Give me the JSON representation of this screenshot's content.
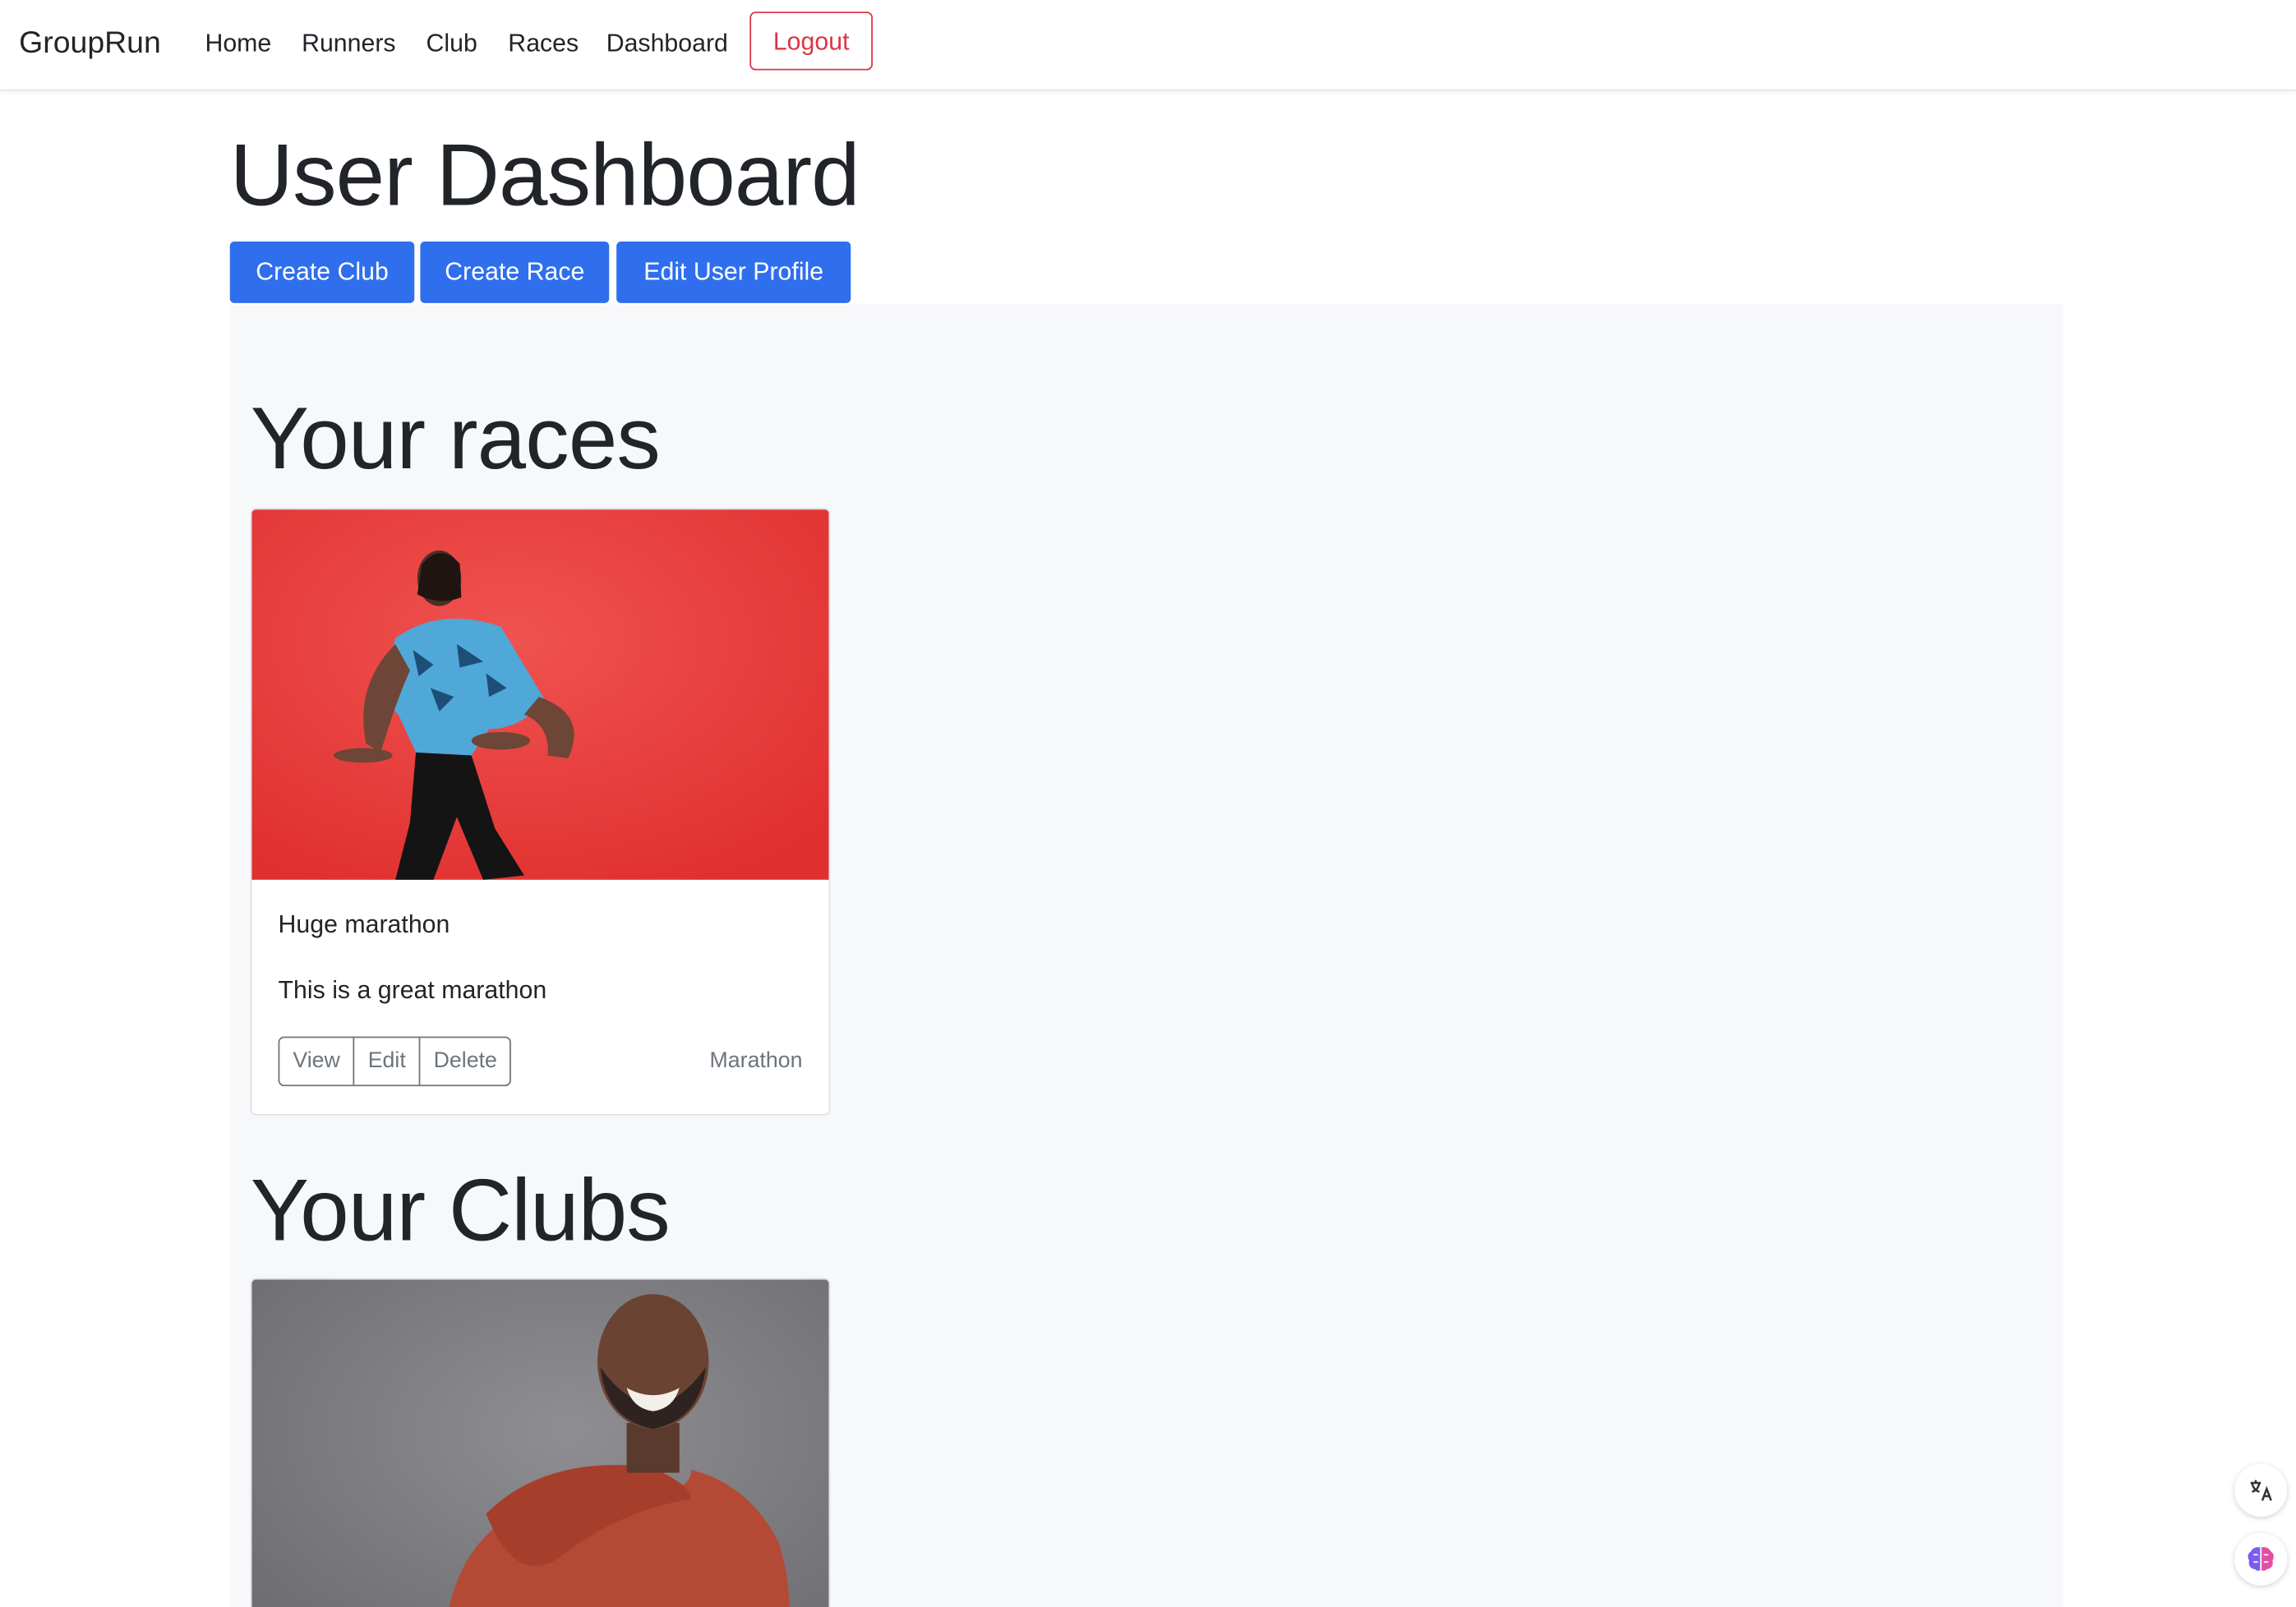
{
  "navbar": {
    "brand": "GroupRun",
    "links": [
      "Home",
      "Runners",
      "Club",
      "Races",
      "Dashboard"
    ],
    "logout_label": "Logout"
  },
  "page": {
    "title": "User Dashboard",
    "actions": [
      "Create Club",
      "Create Race",
      "Edit User Profile"
    ]
  },
  "races": {
    "heading": "Your races",
    "items": [
      {
        "title": "Huge marathon",
        "description": "This is a great marathon",
        "buttons": [
          "View",
          "Edit",
          "Delete"
        ],
        "category": "Marathon",
        "image_bg": "#e53e3e"
      }
    ]
  },
  "clubs": {
    "heading": "Your Clubs",
    "items": [
      {
        "image_bg": "#7b7b7e"
      }
    ]
  },
  "colors": {
    "primary": "#2f6fed",
    "danger": "#dc3545",
    "secondary": "#6c757d",
    "section_bg": "#f7f8fa"
  },
  "floating": {
    "icons": [
      "translate-icon",
      "brain-icon"
    ]
  }
}
